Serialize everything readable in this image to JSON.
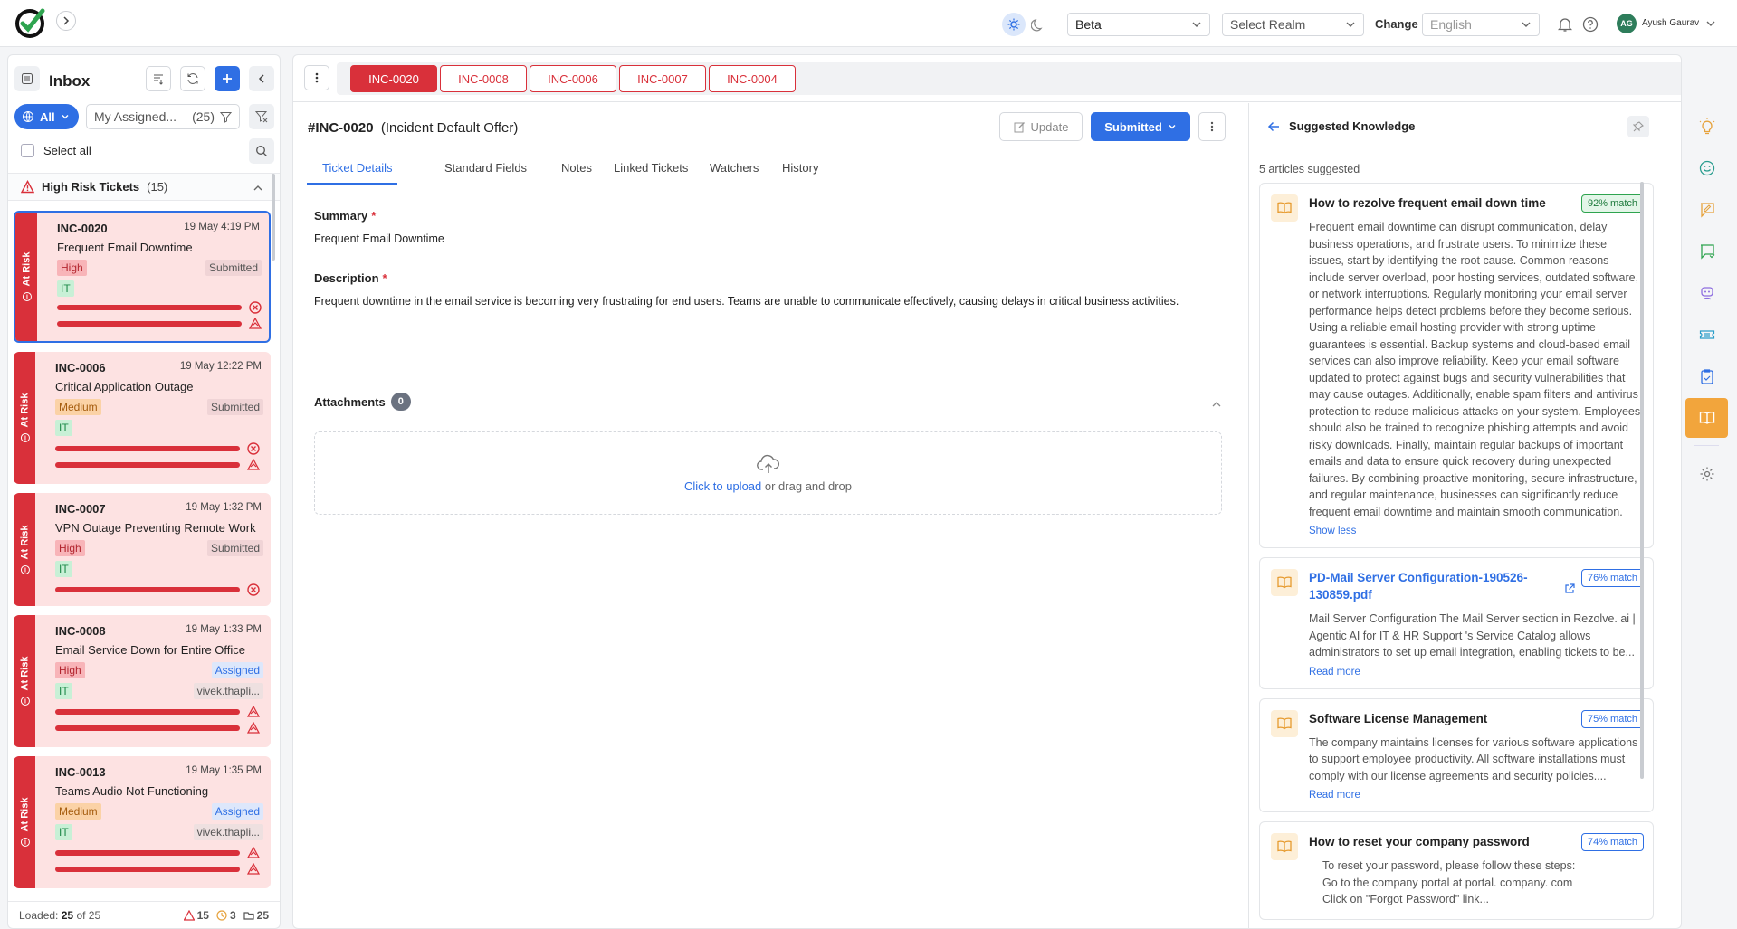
{
  "header": {
    "environment": "Beta",
    "realm_placeholder": "Select Realm",
    "change_label": "Change",
    "language": "English",
    "user_initials": "AG",
    "user_name": "Ayush Gaurav"
  },
  "inbox": {
    "title": "Inbox",
    "filter_all": "All",
    "assigned_label": "My Assigned...",
    "assigned_count": "(25)",
    "select_all": "Select all",
    "group_name": "High Risk Tickets",
    "group_count": "(15)",
    "risk_label": "At Risk",
    "tickets": [
      {
        "id": "INC-0020",
        "time": "19 May 4:19 PM",
        "title": "Frequent Email Downtime",
        "priority": "High",
        "category": "IT",
        "status": "Submitted",
        "assignee": ""
      },
      {
        "id": "INC-0006",
        "time": "19 May 12:22 PM",
        "title": "Critical Application Outage",
        "priority": "Medium",
        "category": "IT",
        "status": "Submitted",
        "assignee": ""
      },
      {
        "id": "INC-0007",
        "time": "19 May 1:32 PM",
        "title": "VPN Outage Preventing Remote Work",
        "priority": "High",
        "category": "IT",
        "status": "Submitted",
        "assignee": ""
      },
      {
        "id": "INC-0008",
        "time": "19 May 1:33 PM",
        "title": "Email Service Down for Entire Office",
        "priority": "High",
        "category": "IT",
        "status": "Assigned",
        "assignee": "vivek.thapli..."
      },
      {
        "id": "INC-0013",
        "time": "19 May 1:35 PM",
        "title": "Teams Audio Not Functioning",
        "priority": "Medium",
        "category": "IT",
        "status": "Assigned",
        "assignee": "vivek.thapli..."
      }
    ],
    "footer": {
      "loaded_label": "Loaded:",
      "loaded": "25",
      "of": "of 25",
      "high_risk": "15",
      "warn": "3",
      "total": "25"
    }
  },
  "tabs": [
    "INC-0020",
    "INC-0008",
    "INC-0006",
    "INC-0007",
    "INC-0004"
  ],
  "detail": {
    "id": "#INC-0020",
    "offer": "(Incident Default Offer)",
    "update_label": "Update",
    "status_label": "Submitted",
    "tabs": [
      "Ticket Details",
      "Standard Fields",
      "Notes",
      "Linked Tickets",
      "Watchers",
      "History"
    ],
    "summary_label": "Summary",
    "summary": "Frequent Email Downtime",
    "description_label": "Description",
    "description": "Frequent downtime in the email service is becoming very frustrating for end users. Teams are unable to communicate effectively, causing delays in critical business activities.",
    "attachments_label": "Attachments",
    "attachments_count": "0",
    "upload_link": "Click to upload",
    "upload_rest": "or drag and drop"
  },
  "knowledge": {
    "title": "Suggested Knowledge",
    "count_text": "5 articles suggested",
    "articles": [
      {
        "title": "How to rezolve frequent email down time",
        "match": "92% match",
        "body": "Frequent email downtime can disrupt communication, delay business operations, and frustrate users. To minimize these issues, start by identifying the root cause. Common reasons include server overload, poor hosting services, outdated software, or network interruptions. Regularly monitoring your email server performance helps detect problems before they become serious. Using a reliable email hosting provider with strong uptime guarantees is essential. Backup systems and cloud-based email services can also improve reliability. Keep your email software updated to protect against bugs and security vulnerabilities that may cause outages. Additionally, enable spam filters and antivirus protection to reduce malicious attacks on your system. Employees should also be trained to recognize phishing attempts and avoid risky downloads. Finally, maintain regular backups of important emails and data to ensure quick recovery during unexpected failures. By combining proactive monitoring, secure infrastructure, and regular maintenance, businesses can significantly reduce frequent email downtime and maintain smooth communication.",
        "more": "Show less"
      },
      {
        "title": "PD-Mail Server Configuration-190526-130859.pdf",
        "match": "76% match",
        "body": "Mail Server Configuration The Mail Server section in Rezolve. ai | Agentic AI for IT & HR Support 's Service Catalog allows administrators to set up email integration, enabling tickets to be...",
        "more": "Read more"
      },
      {
        "title": "Software License Management",
        "match": "75% match",
        "body": "The company maintains licenses for various software applications to support employee productivity. All software installations must comply with our license agreements and security policies....",
        "more": "Read more"
      },
      {
        "title": "How to reset your company password",
        "match": "74% match",
        "body_lines": [
          "To reset your password, please follow these steps:",
          "Go to the company portal at portal. company. com",
          "Click on \"Forgot Password\" link..."
        ]
      }
    ]
  },
  "colors": {
    "accent": "#2f6fe4",
    "risk": "#d9303a",
    "knowledge_active": "#f2a53c"
  }
}
